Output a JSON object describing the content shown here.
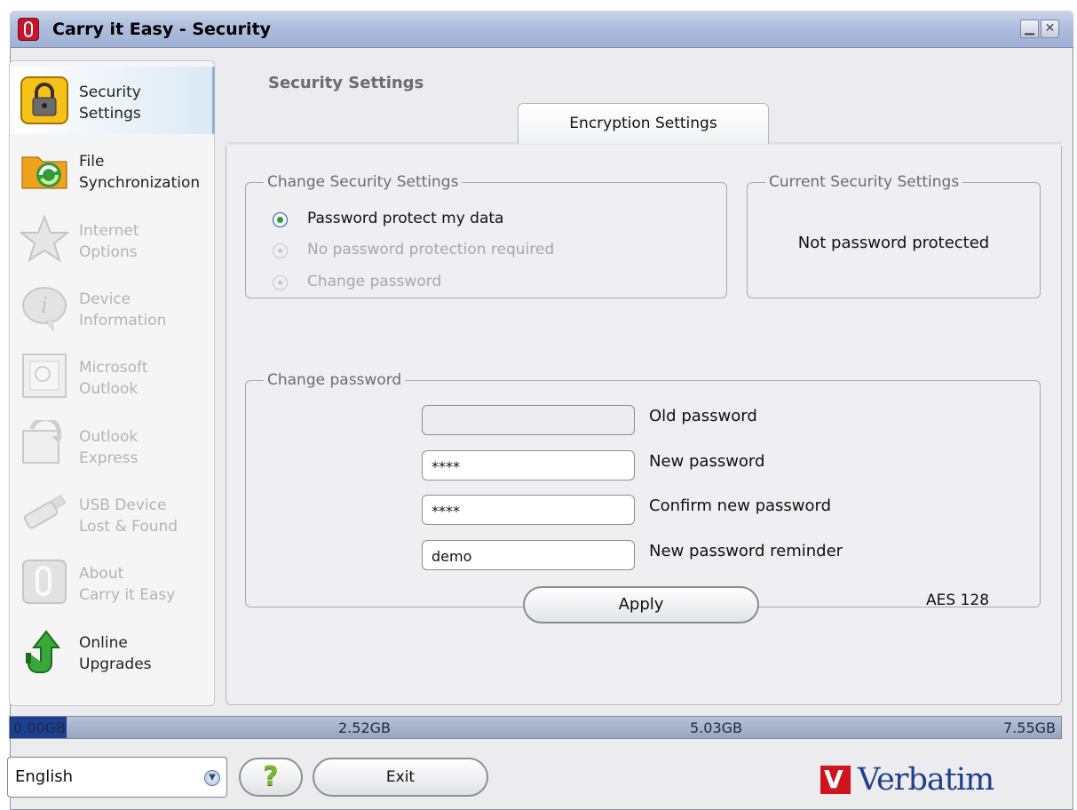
{
  "window": {
    "title": "Carry it Easy - Security",
    "minimize_glyph": "▁",
    "close_glyph": "✕"
  },
  "sidebar": {
    "items": [
      {
        "label_line1": "Security",
        "label_line2": "Settings",
        "icon": "padlock-icon",
        "active": true,
        "enabled": true
      },
      {
        "label_line1": "File",
        "label_line2": "Synchronization",
        "icon": "folder-sync-icon",
        "active": false,
        "enabled": true
      },
      {
        "label_line1": "Internet",
        "label_line2": "Options",
        "icon": "star-icon",
        "active": false,
        "enabled": false
      },
      {
        "label_line1": "Device",
        "label_line2": "Information",
        "icon": "info-bubble-icon",
        "active": false,
        "enabled": false
      },
      {
        "label_line1": "Microsoft",
        "label_line2": "Outlook",
        "icon": "outlook-icon",
        "active": false,
        "enabled": false
      },
      {
        "label_line1": "Outlook",
        "label_line2": "Express",
        "icon": "outlook-express-icon",
        "active": false,
        "enabled": false
      },
      {
        "label_line1": "USB Device",
        "label_line2": "Lost & Found",
        "icon": "usb-drive-icon",
        "active": false,
        "enabled": false
      },
      {
        "label_line1": "About",
        "label_line2": "Carry it Easy",
        "icon": "paperclip-icon",
        "active": false,
        "enabled": false
      },
      {
        "label_line1": "Online",
        "label_line2": "Upgrades",
        "icon": "upgrade-arrow-icon",
        "active": false,
        "enabled": true
      }
    ]
  },
  "main": {
    "section_title": "Security Settings",
    "tab_label": "Encryption Settings",
    "change_security": {
      "legend": "Change Security Settings",
      "options": [
        {
          "label": "Password protect my data",
          "checked": true,
          "enabled": true
        },
        {
          "label": "No password protection required",
          "checked": false,
          "enabled": false
        },
        {
          "label": "Change password",
          "checked": false,
          "enabled": false
        }
      ]
    },
    "current_security": {
      "legend": "Current Security Settings",
      "status": "Not password protected"
    },
    "change_password": {
      "legend": "Change password",
      "old_password": {
        "label": "Old password",
        "value": ""
      },
      "new_password": {
        "label": "New password",
        "value": "****"
      },
      "confirm_password": {
        "label": "Confirm new password",
        "value": "****"
      },
      "reminder": {
        "label": "New password reminder",
        "value": "demo"
      },
      "encryption": "AES 128",
      "apply_label": "Apply"
    }
  },
  "capacity": {
    "labels": [
      "0.00GB",
      "2.52GB",
      "5.03GB",
      "7.55GB"
    ],
    "used_fraction": 0.054,
    "used_color": "#1c3f8e"
  },
  "bottom": {
    "language": "English",
    "help_glyph": "?",
    "exit_label": "Exit",
    "brand": "Verbatim",
    "brand_mark": "V",
    "brand_color": "#1f3f8f",
    "brand_accent": "#d0131d"
  }
}
